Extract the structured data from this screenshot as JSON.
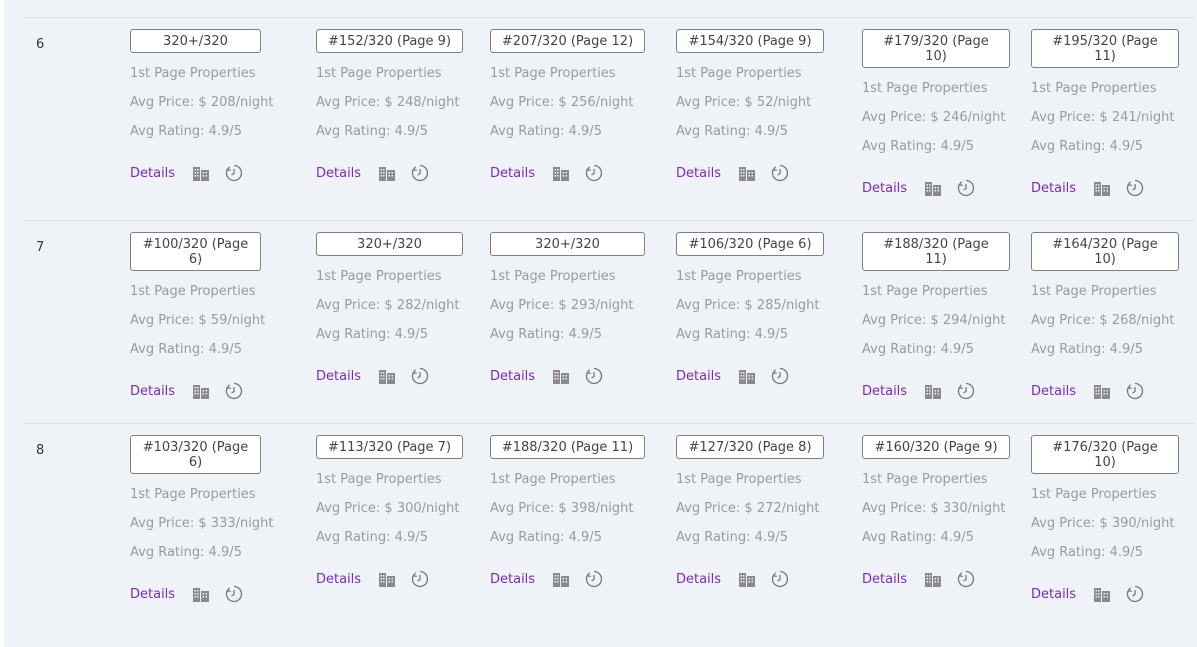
{
  "table": {
    "rows": [
      {
        "num": "6",
        "cells": [
          {
            "rank": "320+/320",
            "label": "1st Page Properties",
            "price": "Avg Price: $ 208/night",
            "rating": "Avg Rating: 4.9/5",
            "details": "Details"
          },
          {
            "rank": "#152/320 (Page 9)",
            "label": "1st Page Properties",
            "price": "Avg Price: $ 248/night",
            "rating": "Avg Rating: 4.9/5",
            "details": "Details"
          },
          {
            "rank": "#207/320 (Page 12)",
            "label": "1st Page Properties",
            "price": "Avg Price: $ 256/night",
            "rating": "Avg Rating: 4.9/5",
            "details": "Details"
          },
          {
            "rank": "#154/320 (Page 9)",
            "label": "1st Page Properties",
            "price": "Avg Price: $ 52/night",
            "rating": "Avg Rating: 4.9/5",
            "details": "Details"
          },
          {
            "rank": "#179/320 (Page 10)",
            "label": "1st Page Properties",
            "price": "Avg Price: $ 246/night",
            "rating": "Avg Rating: 4.9/5",
            "details": "Details"
          },
          {
            "rank": "#195/320 (Page 11)",
            "label": "1st Page Properties",
            "price": "Avg Price: $ 241/night",
            "rating": "Avg Rating: 4.9/5",
            "details": "Details"
          }
        ]
      },
      {
        "num": "7",
        "cells": [
          {
            "rank": "#100/320 (Page 6)",
            "label": "1st Page Properties",
            "price": "Avg Price: $ 59/night",
            "rating": "Avg Rating: 4.9/5",
            "details": "Details"
          },
          {
            "rank": "320+/320",
            "label": "1st Page Properties",
            "price": "Avg Price: $ 282/night",
            "rating": "Avg Rating: 4.9/5",
            "details": "Details"
          },
          {
            "rank": "320+/320",
            "label": "1st Page Properties",
            "price": "Avg Price: $ 293/night",
            "rating": "Avg Rating: 4.9/5",
            "details": "Details"
          },
          {
            "rank": "#106/320 (Page 6)",
            "label": "1st Page Properties",
            "price": "Avg Price: $ 285/night",
            "rating": "Avg Rating: 4.9/5",
            "details": "Details"
          },
          {
            "rank": "#188/320 (Page 11)",
            "label": "1st Page Properties",
            "price": "Avg Price: $ 294/night",
            "rating": "Avg Rating: 4.9/5",
            "details": "Details"
          },
          {
            "rank": "#164/320 (Page 10)",
            "label": "1st Page Properties",
            "price": "Avg Price: $ 268/night",
            "rating": "Avg Rating: 4.9/5",
            "details": "Details"
          }
        ]
      },
      {
        "num": "8",
        "cells": [
          {
            "rank": "#103/320 (Page 6)",
            "label": "1st Page Properties",
            "price": "Avg Price: $ 333/night",
            "rating": "Avg Rating: 4.9/5",
            "details": "Details"
          },
          {
            "rank": "#113/320 (Page 7)",
            "label": "1st Page Properties",
            "price": "Avg Price: $ 300/night",
            "rating": "Avg Rating: 4.9/5",
            "details": "Details"
          },
          {
            "rank": "#188/320 (Page 11)",
            "label": "1st Page Properties",
            "price": "Avg Price: $ 398/night",
            "rating": "Avg Rating: 4.9/5",
            "details": "Details"
          },
          {
            "rank": "#127/320 (Page 8)",
            "label": "1st Page Properties",
            "price": "Avg Price: $ 272/night",
            "rating": "Avg Rating: 4.9/5",
            "details": "Details"
          },
          {
            "rank": "#160/320 (Page 9)",
            "label": "1st Page Properties",
            "price": "Avg Price: $ 330/night",
            "rating": "Avg Rating: 4.9/5",
            "details": "Details"
          },
          {
            "rank": "#176/320 (Page 10)",
            "label": "1st Page Properties",
            "price": "Avg Price: $ 390/night",
            "rating": "Avg Rating: 4.9/5",
            "details": "Details"
          }
        ]
      }
    ],
    "icons": {
      "buildings": "buildings-icon",
      "history": "history-icon"
    },
    "colors": {
      "background": "#eff3f8",
      "link": "#7a2bb0",
      "muted": "#9a9a9a",
      "icon": "#8a8a8a"
    }
  }
}
